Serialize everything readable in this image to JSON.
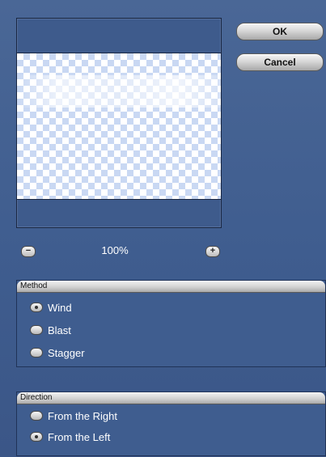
{
  "buttons": {
    "ok": "OK",
    "cancel": "Cancel"
  },
  "zoom": {
    "level": "100%",
    "minus": "−",
    "plus": "+"
  },
  "method": {
    "title": "Method",
    "options": [
      {
        "label": "Wind",
        "checked": true
      },
      {
        "label": "Blast",
        "checked": false
      },
      {
        "label": "Stagger",
        "checked": false
      }
    ]
  },
  "direction": {
    "title": "Direction",
    "options": [
      {
        "label": "From the Right",
        "checked": false
      },
      {
        "label": "From the Left",
        "checked": true
      }
    ]
  },
  "colors": {
    "dialog_background": "#42608f",
    "checker_light": "#c9d8f3",
    "button_gradient_top": "#f6f6f6"
  }
}
